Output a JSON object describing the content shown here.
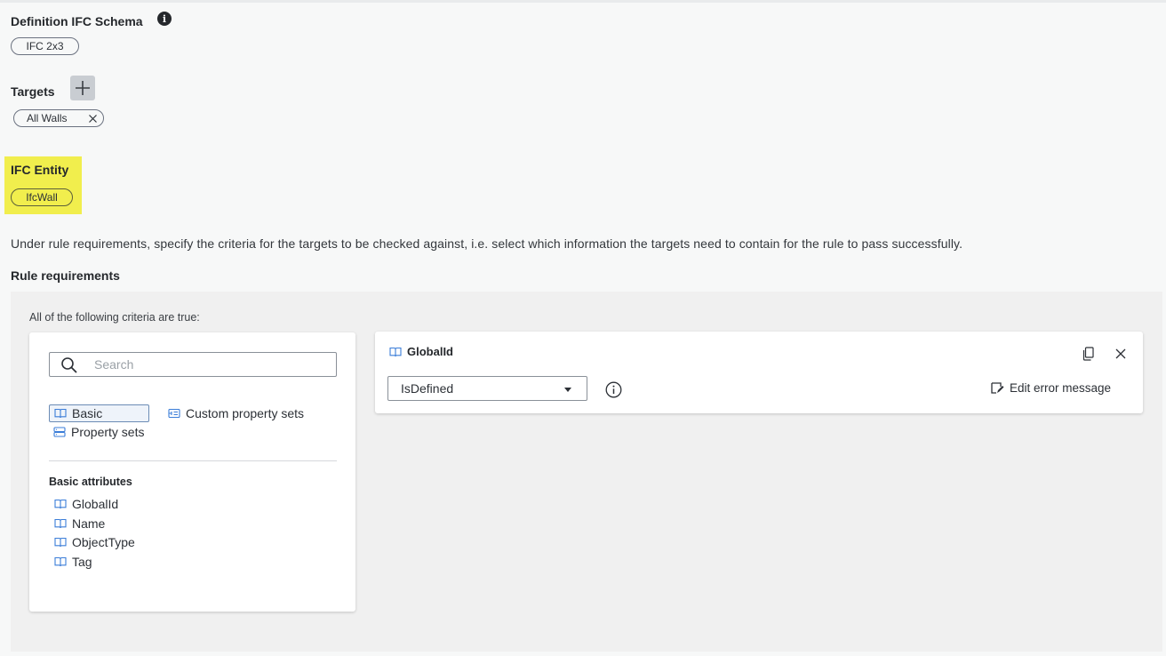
{
  "schema": {
    "label": "Definition IFC Schema",
    "value": "IFC 2x3"
  },
  "targets": {
    "label": "Targets",
    "items": [
      "All Walls"
    ]
  },
  "entity": {
    "label": "IFC Entity",
    "value": "IfcWall",
    "highlight_color": "#f1ee4d"
  },
  "description": "Under rule requirements, specify the criteria for the targets to be checked against, i.e. select which information the targets need to contain for the rule to pass successfully.",
  "requirements": {
    "title": "Rule requirements",
    "caption": "All of the following criteria are true:",
    "search": {
      "placeholder": "Search",
      "value": ""
    },
    "tabs": [
      {
        "label": "Basic",
        "active": true,
        "icon": "book-icon"
      },
      {
        "label": "Custom property sets",
        "active": false,
        "icon": "custom-set-icon"
      },
      {
        "label": "Property sets",
        "active": false,
        "icon": "property-set-icon"
      }
    ],
    "group_title": "Basic attributes",
    "attributes": [
      "GlobalId",
      "Name",
      "ObjectType",
      "Tag"
    ],
    "criterion": {
      "name": "GlobalId",
      "operator": "IsDefined",
      "edit_label": "Edit error message"
    }
  },
  "colors": {
    "accent_icon": "#3b7dd8",
    "panel_bg": "#f0f0f0"
  }
}
